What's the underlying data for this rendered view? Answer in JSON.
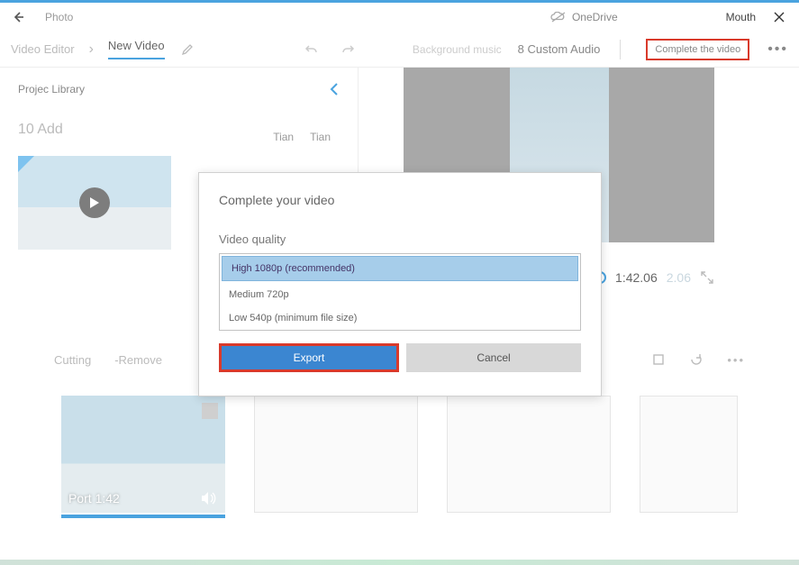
{
  "titlebar": {
    "app": "Photo",
    "onedrive": "OneDrive",
    "right_word": "Mouth"
  },
  "toolbar": {
    "breadcrumb": "Video Editor",
    "project_name": "New Video",
    "bg_music": "Background music",
    "custom_audio": "8 Custom Audio",
    "complete": "Complete the video"
  },
  "library": {
    "title": "Projec Library",
    "add": "10 Add",
    "tags": [
      "Tian",
      "Tian"
    ]
  },
  "preview": {
    "time": "1:42.06",
    "time_suffix": "2.06"
  },
  "editbar": {
    "cutting": "Cutting",
    "remove": "-Remove"
  },
  "clip": {
    "label": "Port 1:42"
  },
  "modal": {
    "title": "Complete your video",
    "sub": "Video quality",
    "q_high": "High 1080p (recommended)",
    "q_med": "Medium 720p",
    "q_low": "Low 540p (minimum file size)",
    "export": "Export",
    "cancel": "Cancel"
  }
}
